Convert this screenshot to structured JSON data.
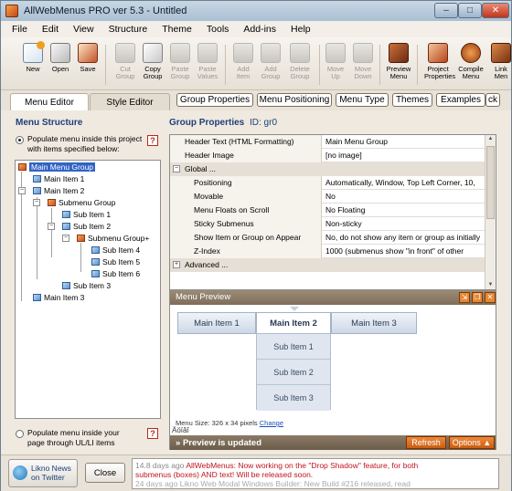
{
  "window": {
    "title": "AllWebMenus PRO ver 5.3 - Untitled",
    "min": "–",
    "max": "□",
    "close": "✕"
  },
  "menubar": [
    "File",
    "Edit",
    "View",
    "Structure",
    "Theme",
    "Tools",
    "Add-ins",
    "Help"
  ],
  "toolbar": {
    "new": "New",
    "open": "Open",
    "save": "Save",
    "cut1": "Cut",
    "cut2": "Group",
    "copy1": "Copy",
    "copy2": "Group",
    "paste1": "Paste",
    "paste2": "Group",
    "pastev1": "Paste",
    "pastev2": "Values",
    "additem1": "Add",
    "additem2": "Item",
    "addgroup1": "Add",
    "addgroup2": "Group",
    "del1": "Delete",
    "del2": "Group",
    "mup1": "Move",
    "mup2": "Up",
    "mdown1": "Move",
    "mdown2": "Down",
    "prev1": "Preview",
    "prev2": "Menu",
    "proj1": "Project",
    "proj2": "Properties",
    "comp1": "Compile",
    "comp2": "Menu",
    "link1": "Link",
    "link2": "Men"
  },
  "tabs": {
    "menu_editor": "Menu Editor",
    "style_editor": "Style Editor",
    "group_properties": "Group Properties",
    "menu_positioning": "Menu Positioning",
    "menu_type": "Menu Type",
    "themes": "Themes",
    "examples": "Examples",
    "overflow": "ck"
  },
  "left": {
    "heading": "Menu Structure",
    "populate1": "Populate menu inside this project",
    "populate1b": "with items specified below:",
    "populate2": "Populate menu inside your",
    "populate2b": "page through UL/LI items",
    "help": "?",
    "tree": [
      {
        "label": "Main Menu Group",
        "kind": "group"
      },
      {
        "label": "Main Item 1",
        "kind": "item"
      },
      {
        "label": "Main Item 2",
        "kind": "item"
      },
      {
        "label": "Submenu Group",
        "kind": "group"
      },
      {
        "label": "Sub Item 1",
        "kind": "item"
      },
      {
        "label": "Sub Item 2",
        "kind": "item"
      },
      {
        "label": "Submenu Group+",
        "kind": "group"
      },
      {
        "label": "Sub Item 4",
        "kind": "item"
      },
      {
        "label": "Sub Item 5",
        "kind": "item"
      },
      {
        "label": "Sub Item 6",
        "kind": "item"
      },
      {
        "label": "Sub Item 3",
        "kind": "item"
      },
      {
        "label": "Main Item 3",
        "kind": "item"
      }
    ]
  },
  "props": {
    "heading": "Group Properties",
    "id": "ID: gr0",
    "rows": [
      {
        "name": "Header Text (HTML Formatting)",
        "value": "Main Menu Group"
      },
      {
        "name": "Header Image",
        "value": "[no image]"
      },
      {
        "name": "Global ...",
        "value": "",
        "group": true
      },
      {
        "name": "Positioning",
        "value": "Automatically, Window, Top Left Corner, 10,"
      },
      {
        "name": "Movable",
        "value": "No"
      },
      {
        "name": "Menu Floats on Scroll",
        "value": "No Floating"
      },
      {
        "name": "Sticky Submenus",
        "value": "Non-sticky"
      },
      {
        "name": "Show Item or Group on Appear",
        "value": "No, do not show any item or group as initially"
      },
      {
        "name": "Z-Index",
        "value": "1000 (submenus show \"in front\" of other"
      },
      {
        "name": "Advanced ...",
        "value": "",
        "group": true
      }
    ]
  },
  "preview": {
    "title": "Menu Preview",
    "main_items": [
      "Main Item 1",
      "Main Item 2",
      "Main Item 3"
    ],
    "sub_items": [
      "Sub Item 1",
      "Sub Item 2",
      "Sub Item 3"
    ],
    "size": "Menu Size: 326 x 34 pixels",
    "change": "Change",
    "junk": "Äöïâî",
    "status": "Preview is updated",
    "refresh": "Refresh",
    "options": "Options ▲"
  },
  "bottom": {
    "likno1": "Likno News",
    "likno2": "on Twitter",
    "close": "Close",
    "news1a": "14.8 days ago",
    "news1b": "AllWebMenus: Now working on the \"Drop Shadow\" feature, for both",
    "news1c": "submenus (boxes) AND text! Will be released soon.",
    "news2": "24 days ago  Likno Web Modal Windows Builder: New Build #216 released, read"
  },
  "colors": {
    "accent_orange": "#e88731",
    "selection": "#3163c5",
    "heading_blue": "#1e3f78"
  }
}
